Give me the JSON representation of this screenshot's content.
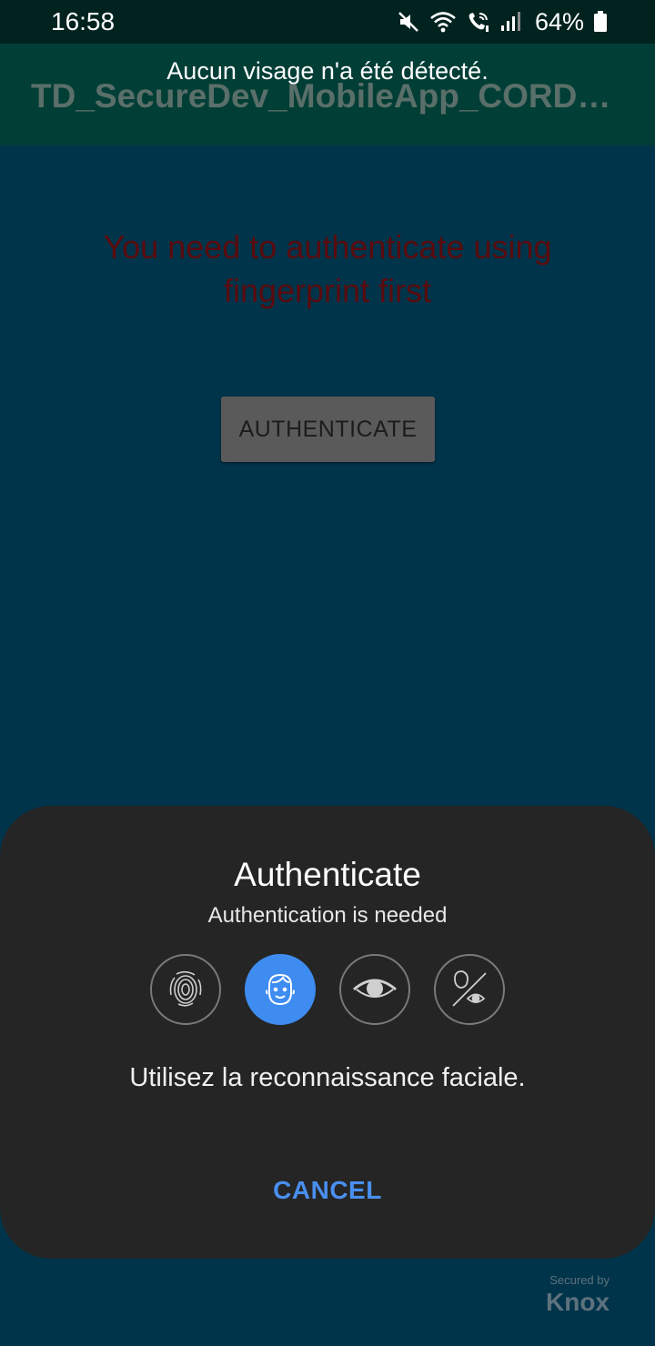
{
  "status_bar": {
    "time": "16:58",
    "battery": "64%",
    "icons": [
      "mute-icon",
      "wifi-icon",
      "wifi-calling-icon",
      "signal-icon",
      "battery-icon"
    ]
  },
  "app_bar": {
    "title": "TD_SecureDev_MobileApp_CORDIER"
  },
  "toast": {
    "message": "Aucun visage n'a été détecté."
  },
  "main": {
    "prompt": "You need to authenticate using fingerprint first",
    "authenticate_button": "AUTHENTICATE"
  },
  "biometric_sheet": {
    "title": "Authenticate",
    "subtitle": "Authentication is needed",
    "options": [
      {
        "icon": "fingerprint-icon",
        "active": false
      },
      {
        "icon": "face-icon",
        "active": true
      },
      {
        "icon": "iris-icon",
        "active": false
      },
      {
        "icon": "intelligent-scan-icon",
        "active": false
      }
    ],
    "message": "Utilisez la reconnaissance faciale.",
    "cancel_label": "CANCEL"
  },
  "watermark": {
    "line1": "Secured by",
    "line2": "Knox"
  },
  "colors": {
    "background": "#00344a",
    "status_bar": "#00231f",
    "app_bar": "#003e36",
    "prompt_text": "#5a0b0e",
    "button": "#5a5a5a",
    "sheet": "#252525",
    "accent": "#3e8cf0"
  }
}
